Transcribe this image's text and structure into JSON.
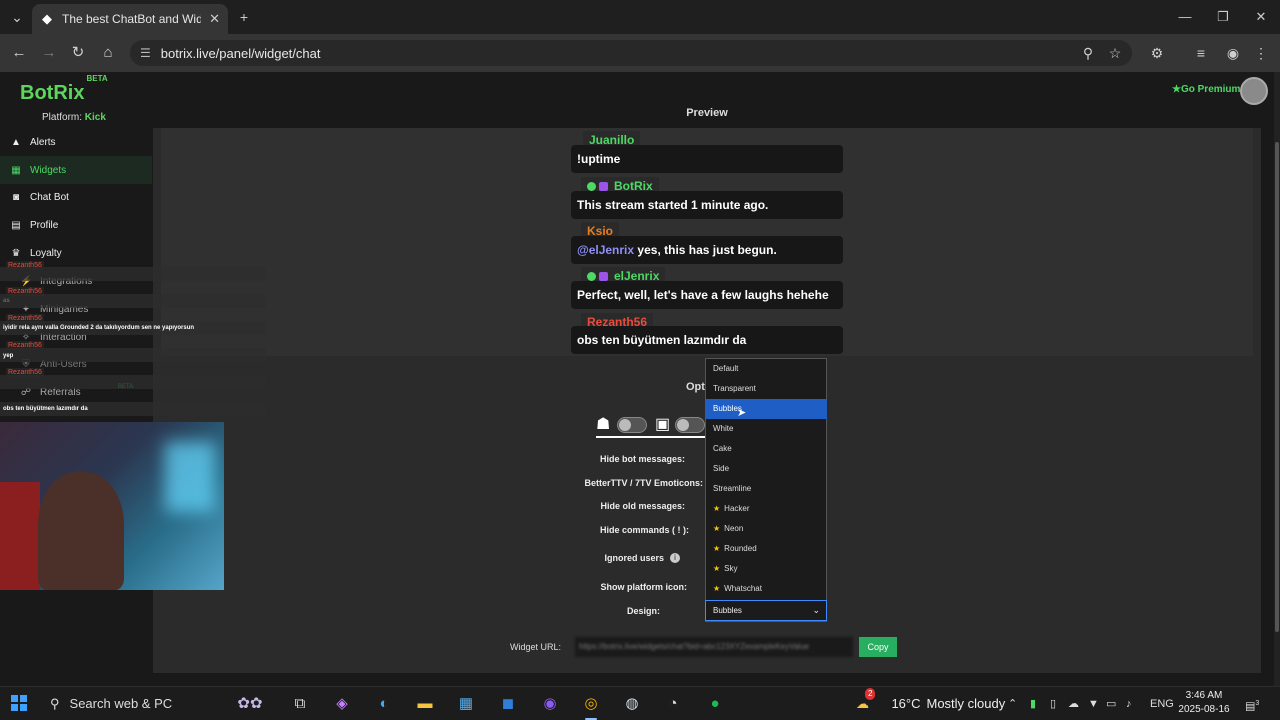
{
  "browser": {
    "tab_title": "The best ChatBot and Widgets",
    "url": "botrix.live/panel/widget/chat"
  },
  "app": {
    "logo": "BotRix",
    "logo_badge": "BETA",
    "platform_label": "Platform:",
    "platform_value": "Kick",
    "premium_label": "Go Premium",
    "accent": "#4cd964"
  },
  "sidebar": {
    "items": [
      {
        "label": "Alerts",
        "icon": "warning-icon"
      },
      {
        "label": "Widgets",
        "icon": "grid-icon"
      },
      {
        "label": "Chat Bot",
        "icon": "robot-icon"
      },
      {
        "label": "Profile",
        "icon": "id-card-icon"
      },
      {
        "label": "Loyalty",
        "icon": "trophy-icon"
      },
      {
        "label": "Integrations",
        "icon": "plug-icon"
      },
      {
        "label": "Minigames",
        "icon": "gamepad-icon"
      },
      {
        "label": "Interaction",
        "icon": "interaction-icon"
      },
      {
        "label": "Anti-Users",
        "icon": "shield-icon"
      },
      {
        "label": "Referrals",
        "icon": "referral-icon"
      }
    ],
    "referrals_badge": "BETA"
  },
  "preview": {
    "label": "Preview",
    "messages": [
      {
        "name": "Juanillo",
        "name_color": "#4cd964",
        "badges": false,
        "text": "!uptime",
        "mention": ""
      },
      {
        "name": "BotRix",
        "name_color": "#4cd964",
        "badges": true,
        "text": "This stream started 1 minute ago.",
        "mention": ""
      },
      {
        "name": "Ksio",
        "name_color": "#e67e22",
        "badges": false,
        "text": "yes, this has just begun.",
        "mention": "@elJenrix"
      },
      {
        "name": "elJenrix",
        "name_color": "#4cd964",
        "badges": true,
        "text": "Perfect, well, let's have a few laughs hehehe",
        "mention": ""
      },
      {
        "name": "Rezanth56",
        "name_color": "#e74c3c",
        "badges": false,
        "text": "obs ten büyütmen lazımdır da",
        "mention": ""
      }
    ]
  },
  "options": {
    "title": "Opt",
    "rows": [
      {
        "label": "Hide bot messages:"
      },
      {
        "label": "BetterTTV / 7TV Emoticons:"
      },
      {
        "label": "Hide old messages:"
      },
      {
        "label": "Hide commands ( ! ):"
      },
      {
        "label": "Ignored users"
      },
      {
        "label": "Show platform icon:"
      },
      {
        "label": "Design:"
      }
    ],
    "design_value": "Bubbles",
    "design_options": [
      {
        "label": "Default",
        "premium": false
      },
      {
        "label": "Transparent",
        "premium": false
      },
      {
        "label": "Bubbles",
        "premium": false,
        "selected": true
      },
      {
        "label": "White",
        "premium": false
      },
      {
        "label": "Cake",
        "premium": false
      },
      {
        "label": "Side",
        "premium": false
      },
      {
        "label": "Streamline",
        "premium": false
      },
      {
        "label": "Hacker",
        "premium": true
      },
      {
        "label": "Neon",
        "premium": true
      },
      {
        "label": "Rounded",
        "premium": true
      },
      {
        "label": "Sky",
        "premium": true
      },
      {
        "label": "Whatschat",
        "premium": true
      }
    ]
  },
  "widget_url": {
    "label": "Widget URL:",
    "value": "https://botrix.live/widgets/chat?bid=abc123XYZexampleKeyValue",
    "copy_label": "Copy"
  },
  "overlay_chat": {
    "lines": [
      {
        "name": "Rezanth56",
        "text": "as"
      },
      {
        "name": "Rezanth56",
        "text": "iyidir rela aynı valla Grounded 2 da takılıyordum sen ne yapıyorsun"
      },
      {
        "name": "Rezanth56",
        "text": "yep"
      },
      {
        "name": "Rezanth56",
        "text": ""
      },
      {
        "name": "Rezanth56",
        "text": "obs ten büyütmen lazımdır da"
      }
    ]
  },
  "taskbar": {
    "search": "Search web & PC",
    "weather_temp": "16°C",
    "weather_desc": "Mostly cloudy",
    "weather_badge": "2",
    "lang": "ENG",
    "time": "3:46 AM",
    "date": "2025-08-16",
    "notif_count": "3"
  }
}
